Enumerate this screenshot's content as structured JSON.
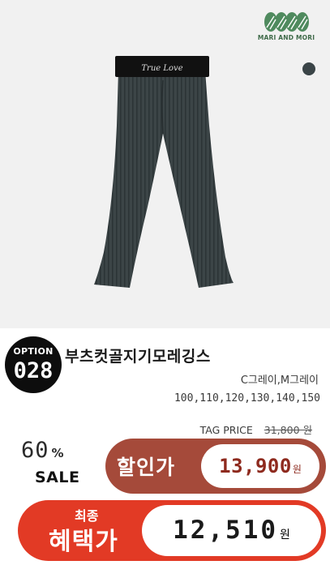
{
  "brand": {
    "name": "MARI AND MORI",
    "color": "#3f6a49"
  },
  "swatch": {
    "color": "#3a4447"
  },
  "product_image": {
    "waistband_text": "True Love"
  },
  "option": {
    "label": "OPTION",
    "number": "028"
  },
  "product": {
    "name": "부츠컷골지기모레깅스",
    "colors": "C그레이,M그레이",
    "sizes": "100,110,120,130,140,150"
  },
  "pricing": {
    "tag_label": "TAG PRICE",
    "tag_price": "31,800 원",
    "discount_percent": "60",
    "percent_sign": "%",
    "sale_word": "SALE",
    "sale_label": "할인가",
    "sale_price": "13,900",
    "won": "원",
    "final_top": "최종",
    "final_label": "혜택가",
    "final_price": "12,510"
  },
  "colors": {
    "sale_pill": "#a54a3a",
    "final_pill": "#e23a25",
    "badge": "#0d0d0d"
  }
}
